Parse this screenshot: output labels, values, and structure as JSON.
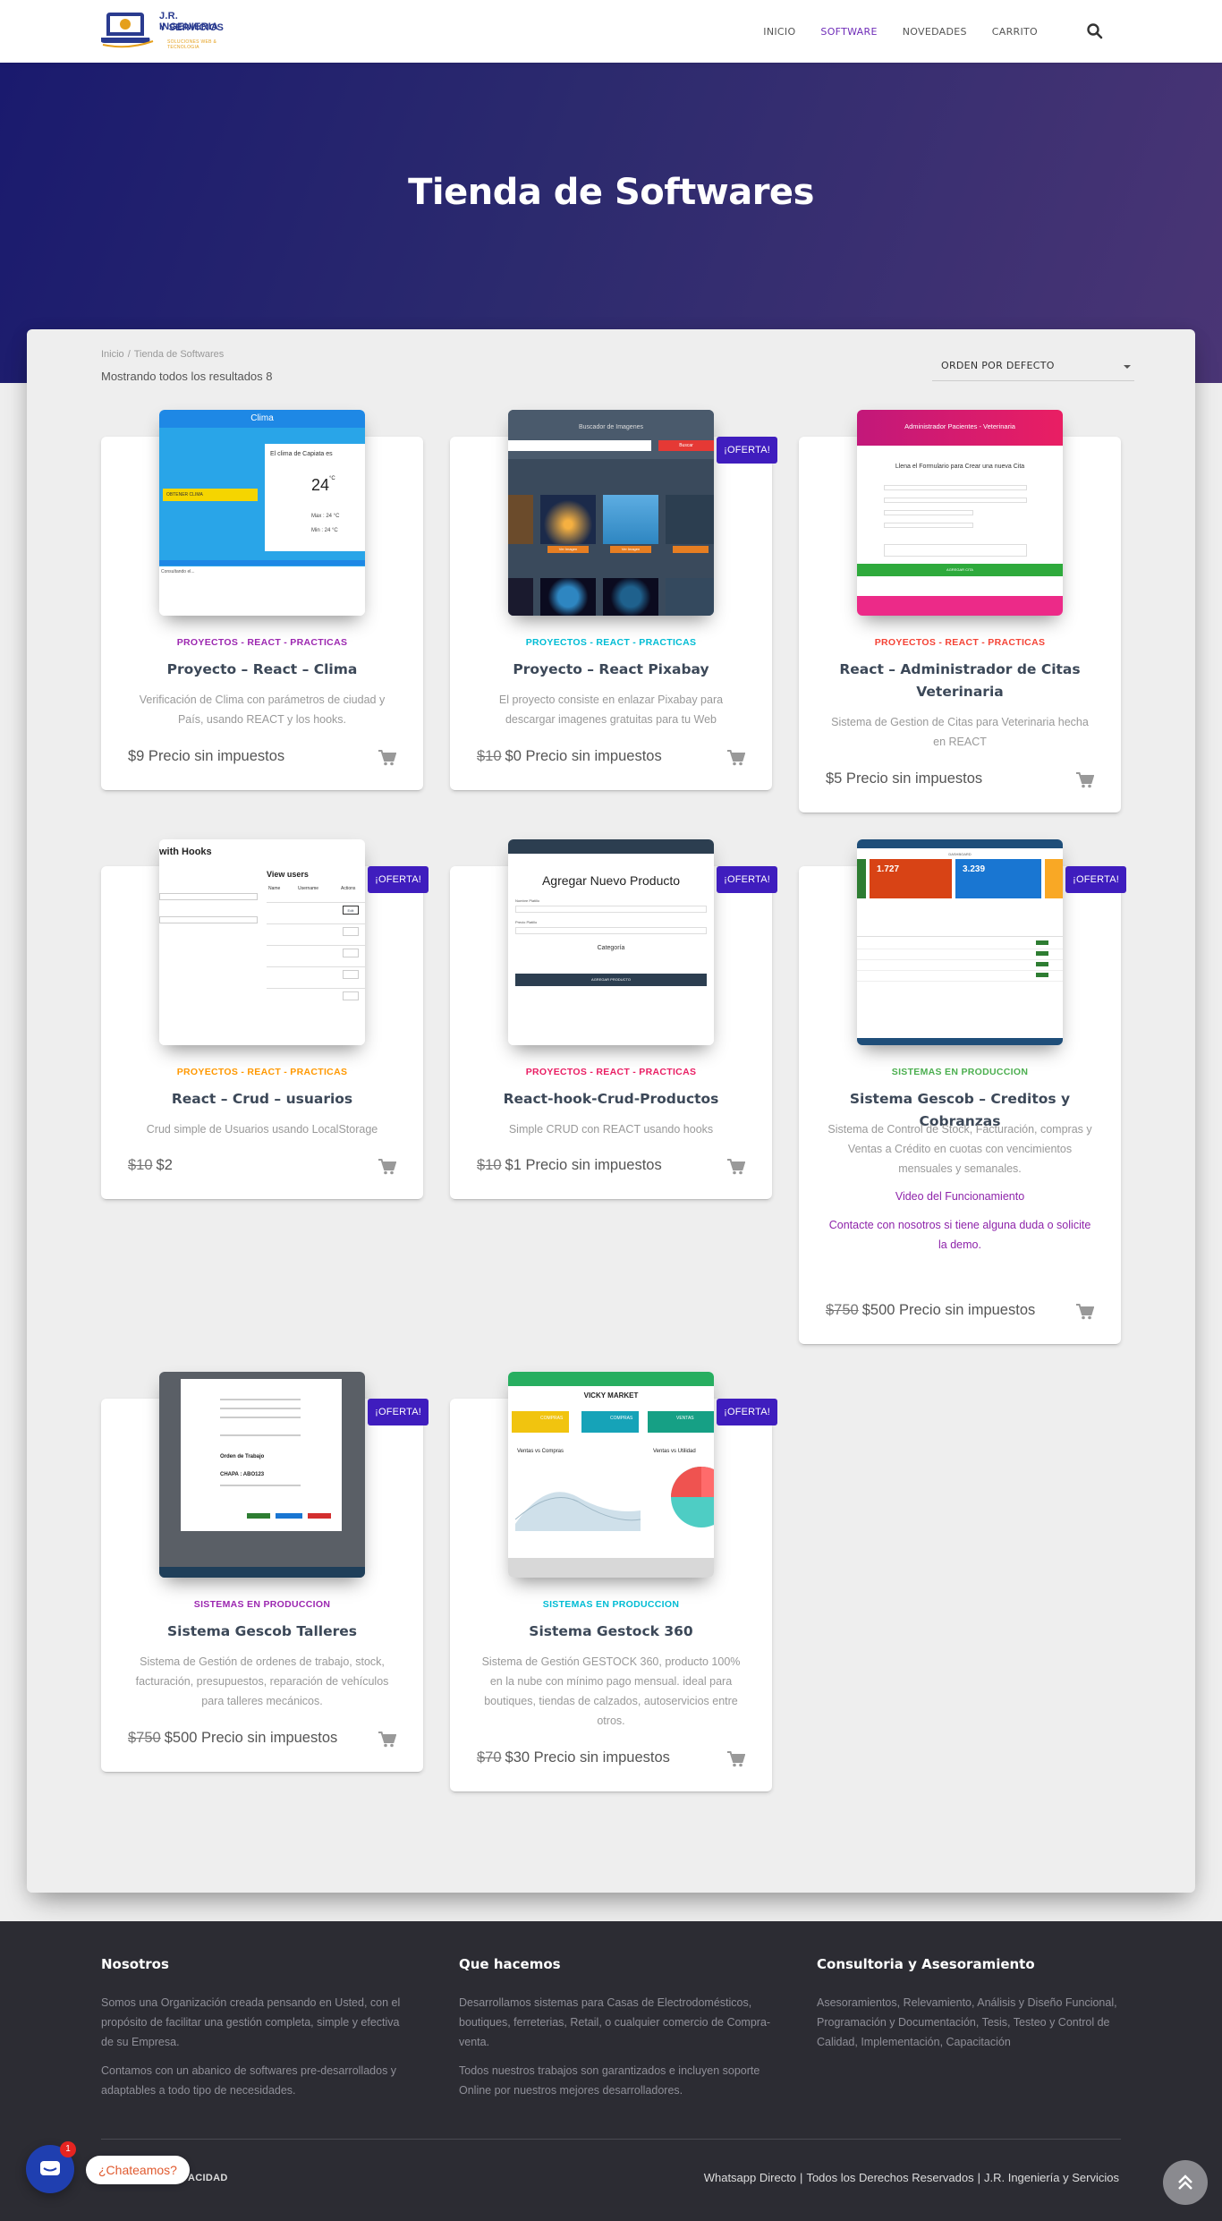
{
  "logo": {
    "line1": "J.R. INGENIERIA",
    "line2": "Y SERVICIOS",
    "tagline": "SOLUCIONES WEB & TECNOLOGIA"
  },
  "nav": {
    "items": [
      "INICIO",
      "SOFTWARE",
      "NOVEDADES",
      "CARRITO"
    ],
    "active": "SOFTWARE"
  },
  "hero": {
    "title": "Tienda de Softwares"
  },
  "shop": {
    "breadcrumb_home": "Inicio",
    "breadcrumb_sep": "/",
    "breadcrumb_current": "Tienda de Softwares",
    "result_count": "Mostrando todos los resultados 8",
    "orderby": "ORDEN POR DEFECTO",
    "sale_label": "¡OFERTA!"
  },
  "products": [
    {
      "category": "PROYECTOS - REACT - PRACTICAS",
      "category_color": "#9c27b0",
      "title": "Proyecto – React – Clima",
      "description": "Verificación de Clima con parámetros de ciudad y País, usando REACT y los hooks.",
      "old_price": "",
      "price": "$9 Precio sin impuestos",
      "sale": false
    },
    {
      "category": "PROYECTOS - REACT - PRACTICAS",
      "category_color": "#00bcd4",
      "title": "Proyecto – React Pixabay",
      "description": "El proyecto consiste en enlazar Pixabay para descargar imagenes gratuitas para tu Web",
      "old_price": "$10",
      "price": "$0 Precio sin impuestos",
      "sale": true
    },
    {
      "category": "PROYECTOS - REACT - PRACTICAS",
      "category_color": "#f44336",
      "title": "React – Administrador de Citas Veterinaria",
      "description": "Sistema de Gestion de Citas para Veterinaria hecha en REACT",
      "old_price": "",
      "price": "$5 Precio sin impuestos",
      "sale": false
    },
    {
      "category": "PROYECTOS - REACT - PRACTICAS",
      "category_color": "#ff9800",
      "title": "React – Crud – usuarios",
      "description": "Crud simple de Usuarios usando LocalStorage",
      "old_price": "$10",
      "price": "$2",
      "sale": true
    },
    {
      "category": "PROYECTOS - REACT - PRACTICAS",
      "category_color": "#e91e63",
      "title": "React-hook-Crud-Productos",
      "description": "Simple CRUD con REACT usando hooks",
      "old_price": "$10",
      "price": "$1 Precio sin impuestos",
      "sale": true
    },
    {
      "category": "SISTEMAS EN PRODUCCION",
      "category_color": "#4caf50",
      "title": "Sistema Gescob – Creditos y Cobranzas",
      "description": "Sistema de Control de Stock, Facturación, compras y Ventas a Crédito en cuotas con vencimientos mensuales y semanales.",
      "link1": "Video del Funcionamiento",
      "link2": "Contacte con nosotros si tiene alguna duda o solicite la demo.",
      "old_price": "$750",
      "price": "$500 Precio sin impuestos",
      "sale": true
    },
    {
      "category": "SISTEMAS EN PRODUCCION",
      "category_color": "#9c27b0",
      "title": "Sistema Gescob Talleres",
      "description": "Sistema de Gestión de ordenes de trabajo, stock, facturación, presupuestos, reparación de vehículos para talleres mecánicos.",
      "old_price": "$750",
      "price": "$500 Precio sin impuestos",
      "sale": true
    },
    {
      "category": "SISTEMAS EN PRODUCCION",
      "category_color": "#00bcd4",
      "title": "Sistema Gestock 360",
      "description": "Sistema de Gestión GESTOCK 360, producto 100% en la nube con mínimo pago mensual. ideal para boutiques, tiendas de calzados, autoservicios entre otros.",
      "old_price": "$70",
      "price": "$30 Precio sin impuestos",
      "sale": true
    }
  ],
  "thumbs": {
    "clima": {
      "header": "Clima",
      "question": "El clima de Capiata es",
      "temp": "24",
      "unit": "°C",
      "max": "Max : 24 °C",
      "min": "Min : 24 °C",
      "button": "OBTENER CLIMA",
      "foot": "Consultando el..."
    },
    "pixabay": {
      "header": "Buscador de Imagenes",
      "button": "Buscar",
      "item": "Ver Imagen"
    },
    "citas": {
      "header": "Administrador Pacientes - Veterinaria",
      "sub": "Llena el Formulario para Crear una nueva Cita",
      "button": "AGREGAR CITA"
    },
    "crud": {
      "title": "with Hooks",
      "sub": "View users",
      "col1": "Name",
      "col2": "Username",
      "col3": "Actions",
      "edit": "Edit"
    },
    "producto": {
      "title": "Agregar Nuevo Producto",
      "f1": "Nombre Platillo",
      "f2": "Precio Platillo",
      "cat": "Categoría",
      "button": "AGREGAR PRODUCTO"
    },
    "gescob": {
      "n1": "1.727",
      "n2": "3.239",
      "title": "DASHBOARD"
    },
    "talleres": {
      "title": "Orden de Trabajo",
      "chapa": "CHAPA : ABO123"
    },
    "gestock": {
      "title": "VICKY MARKET",
      "b1": "COMPRAS",
      "b2": "COMPRAS",
      "b3": "VENTAS",
      "c1": "Ventas vs Compras",
      "c2": "Ventas vs Utilidad"
    }
  },
  "footer": {
    "col1_title": "Nosotros",
    "col1_p1": "Somos una Organización creada pensando en Usted, con el propósito de facilitar una gestión completa, simple y efectiva de su Empresa.",
    "col1_p2": "Contamos con un abanico de softwares pre-desarrollados y adaptables a todo tipo de necesidades.",
    "col2_title": "Que hacemos",
    "col2_p1": "Desarrollamos sistemas para Casas de Electrodomésticos, boutiques, ferreterias, Retail, o cualquier comercio de Compra-venta.",
    "col2_p2": "Todos nuestros trabajos son garantizados e incluyen soporte Online por nuestros mejores desarrolladores.",
    "col3_title": "Consultoria y Asesoramiento",
    "col3_p1": "Asesoramientos, Relevamiento, Análisis y Diseño Funcional, Programación y Documentación, Tesis, Testeo y Control de Calidad, Implementación, Capacitación",
    "bottom_left": "ACIDAD",
    "bottom_right": [
      "Whatsapp Directo",
      "Todos los Derechos Reservados",
      "J.R. Ingeniería y Servicios"
    ],
    "sep": "|"
  },
  "chat": {
    "label": "¿Chateamos?",
    "badge": "1"
  },
  "colors": {
    "accent": "#6f2cb8",
    "sale": "#3f1dbe",
    "hero_start": "#1a1a6e",
    "hero_end": "#4a3575",
    "footer": "#2c2c33"
  }
}
